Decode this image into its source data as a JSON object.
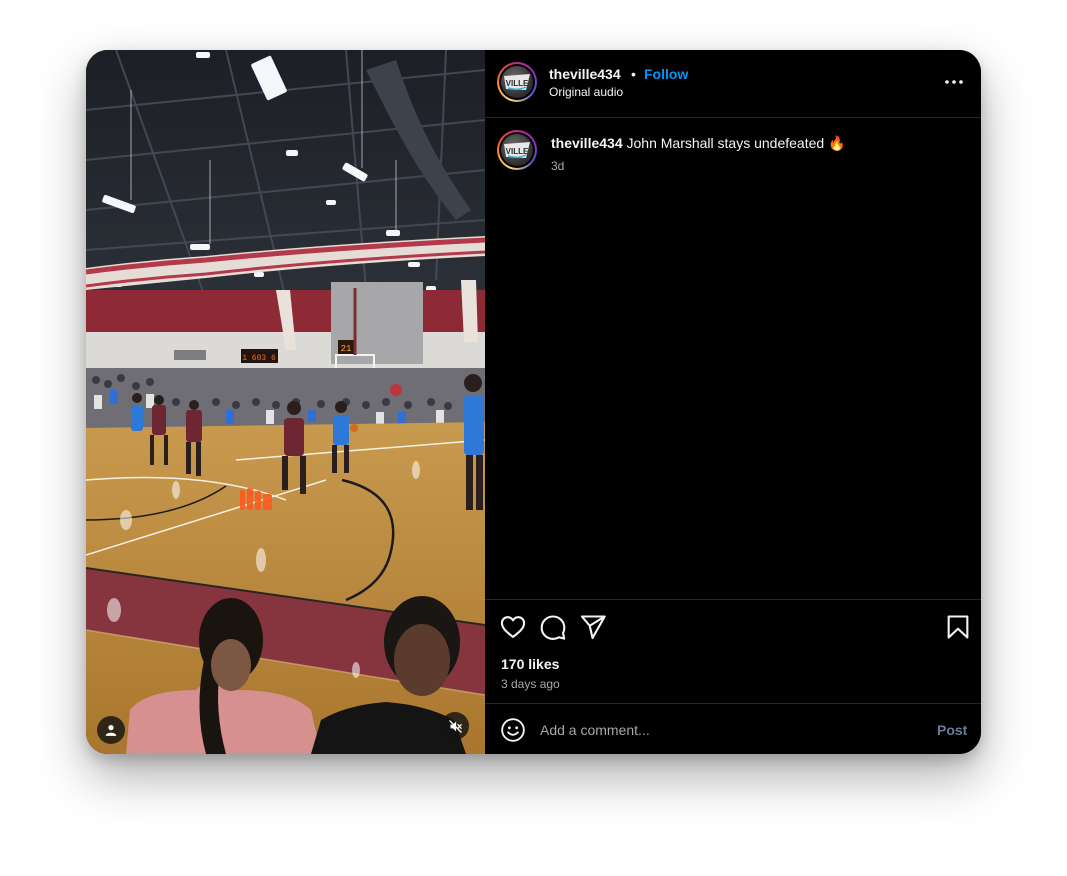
{
  "post": {
    "username": "theville434",
    "separator": "•",
    "follow_label": "Follow",
    "audio_label": "Original audio",
    "avatar_logo_text": "VILLE",
    "caption_text": "John Marshall stays undefeated",
    "caption_emoji": "🔥",
    "caption_age": "3d",
    "likes": "170 likes",
    "posted_ago": "3 days ago"
  },
  "video": {
    "scoreboard_text": "1 603 6",
    "shotclock_text": "21"
  },
  "comment": {
    "placeholder": "Add a comment...",
    "post_label": "Post"
  },
  "icons": {
    "more": "more-options-icon",
    "like": "heart-icon",
    "comment": "comment-bubble-icon",
    "share": "paper-plane-icon",
    "save": "bookmark-icon",
    "emoji": "emoji-smiley-icon",
    "user": "user-tag-icon",
    "mute": "muted-speaker-icon"
  },
  "colors": {
    "follow": "#0095f6",
    "post_disabled": "#6a7b96",
    "background": "#000000",
    "divider": "#262626",
    "secondary_text": "#a8a8a8"
  }
}
